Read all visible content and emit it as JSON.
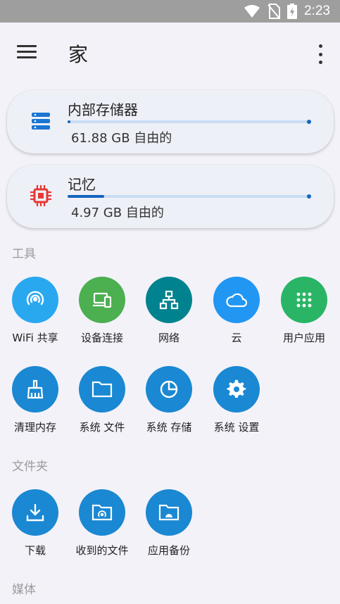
{
  "status_bar": {
    "time": "2:23"
  },
  "header": {
    "title": "家"
  },
  "storage_cards": [
    {
      "title": "内部存储器",
      "free": "61.88 GB 自由的",
      "used_fraction": 0.005
    },
    {
      "title": "记忆",
      "free": "4.97 GB 自由的",
      "used_fraction": 0.15
    }
  ],
  "sections": {
    "tools": "工具",
    "folders": "文件夹",
    "media": "媒体"
  },
  "tools": [
    {
      "label": "WiFi 共享",
      "icon": "wifi-hotspot-icon",
      "color": "#29a8f0"
    },
    {
      "label": "设备连接",
      "icon": "device-connect-icon",
      "color": "#4caf50"
    },
    {
      "label": "网络",
      "icon": "network-icon",
      "color": "#00838f"
    },
    {
      "label": "云",
      "icon": "cloud-icon",
      "color": "#2196f3"
    },
    {
      "label": "用户应用",
      "icon": "apps-grid-icon",
      "color": "#29b565"
    },
    {
      "label": "清理内存",
      "icon": "broom-icon",
      "color": "#1a88d2"
    },
    {
      "label": "系统 文件",
      "icon": "folder-icon",
      "color": "#1a88d2"
    },
    {
      "label": "系统 存储",
      "icon": "pie-chart-icon",
      "color": "#1a88d2"
    },
    {
      "label": "系统 设置",
      "icon": "settings-icon",
      "color": "#1a88d2"
    }
  ],
  "folders": [
    {
      "label": "下载",
      "icon": "download-icon",
      "color": "#1a88d2"
    },
    {
      "label": "收到的文件",
      "icon": "received-folder-icon",
      "color": "#1a88d2"
    },
    {
      "label": "应用备份",
      "icon": "app-backup-folder-icon",
      "color": "#1a88d2"
    }
  ]
}
